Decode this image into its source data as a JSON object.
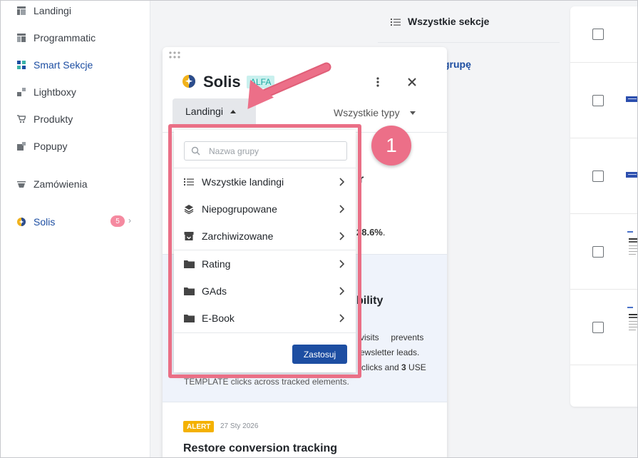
{
  "sidebar": {
    "items": [
      {
        "label": "Landingi",
        "icon": "landing-icon"
      },
      {
        "label": "Programmatic",
        "icon": "programmatic-icon"
      },
      {
        "label": "Smart Sekcje",
        "icon": "smart-sections-icon"
      },
      {
        "label": "Lightboxy",
        "icon": "lightbox-icon"
      },
      {
        "label": "Produkty",
        "icon": "cart-icon"
      },
      {
        "label": "Popupy",
        "icon": "popup-icon"
      },
      {
        "label": "Zamówienia",
        "icon": "orders-icon"
      },
      {
        "label": "Solis",
        "icon": "solis-icon",
        "badge": "5"
      }
    ]
  },
  "main": {
    "header_label": "Wszystkie sekcje",
    "link_fragment": "grupę"
  },
  "panel": {
    "title": "Solis",
    "badge": "ALFA",
    "landing_filter": "Landingi",
    "type_filter": "Wszystkie typy",
    "fragments": {
      "card1_title_tail": "r",
      "card1_pct": "28.6%",
      "card1_dot": ".",
      "card2_title_tail": "bility",
      "card2_line1": "visits     prevents",
      "card2_line2": "ewsletter leads.",
      "card2_line3_a": "clicks and ",
      "card2_line3_b": "3",
      "card2_line3_c": " USE",
      "card2_line4": "TEMPLATE clicks across tracked elements."
    },
    "card3": {
      "badge": "ALERT",
      "date": "27 Sty 2026",
      "title": "Restore conversion tracking"
    }
  },
  "dropdown": {
    "search_placeholder": "Nazwa grupy",
    "items": [
      {
        "label": "Wszystkie landingi",
        "icon": "list-icon"
      },
      {
        "label": "Niepogrupowane",
        "icon": "layers-icon"
      },
      {
        "label": "Zarchiwizowane",
        "icon": "archive-icon"
      },
      {
        "label": "Rating",
        "icon": "folder-icon"
      },
      {
        "label": "GAds",
        "icon": "folder-icon"
      },
      {
        "label": "E-Book",
        "icon": "folder-icon"
      }
    ],
    "apply_label": "Zastosuj"
  },
  "annotation": {
    "step": "1",
    "color": "#ea6f86"
  },
  "colors": {
    "accent": "#1d4ea2",
    "alert": "#f4b100",
    "alfa_bg": "#c9f0ee"
  }
}
